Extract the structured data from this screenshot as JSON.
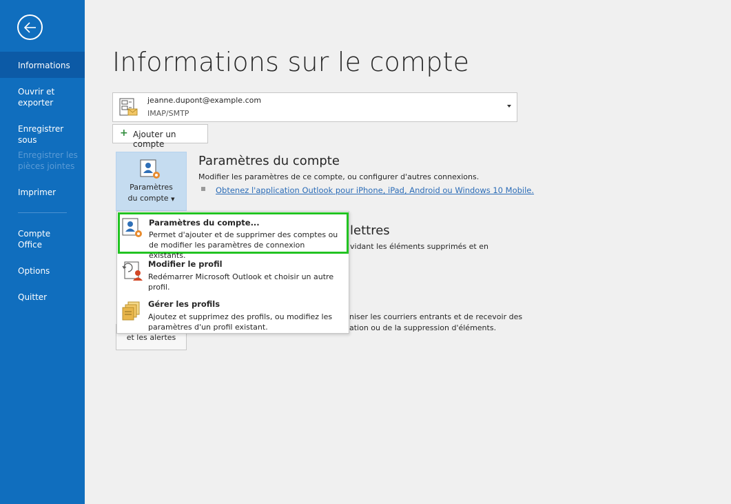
{
  "sidebar": {
    "back_label": "",
    "items": [
      {
        "label": "Informations"
      },
      {
        "label": "Ouvrir et\nexporter"
      },
      {
        "label": "Enregistrer sous"
      },
      {
        "label": "Enregistrer les\npièces jointes"
      },
      {
        "label": "Imprimer"
      },
      {
        "label": "Compte\nOffice"
      },
      {
        "label": "Options"
      },
      {
        "label": "Quitter"
      }
    ]
  },
  "page": {
    "title": "Informations sur le compte"
  },
  "account": {
    "email": "jeanne.dupont@example.com",
    "type": "IMAP/SMTP"
  },
  "add_account": {
    "label": "Ajouter un compte"
  },
  "account_settings": {
    "tile_label_line1": "Paramètres",
    "tile_label_line2": "du compte",
    "title": "Paramètres du compte",
    "description": "Modifier les paramètres de ce compte, ou configurer d'autres connexions.",
    "link": "Obtenez l'application Outlook pour iPhone, iPad, Android ou Windows 10 Mobile."
  },
  "background_sections": {
    "mailbox_title_partial": "lettres",
    "mailbox_text_partial": "vidant les éléments supprimés et en",
    "rules_text_line1_partial": "niser les courriers entrants et de recevoir des",
    "rules_text_line2_partial": "ation ou de la suppression d'éléments.",
    "alerts_tile_label": "et les alertes"
  },
  "menu": {
    "items": [
      {
        "title": "Paramètres du compte...",
        "description": "Permet d'ajouter et de supprimer des comptes ou de modifier les paramètres de connexion existants."
      },
      {
        "title": "Modifier le profil",
        "description": "Redémarrer Microsoft Outlook et choisir un autre profil."
      },
      {
        "title": "Gérer les profils",
        "description": "Ajoutez et supprimez des profils, ou modifiez les paramètres d'un profil existant."
      }
    ]
  },
  "colors": {
    "sidebar_bg": "#106ebe",
    "sidebar_active": "#0c5aa6",
    "tile_selected": "#c5dcf0",
    "highlight_border": "#22c322",
    "link": "#2b6cb7"
  }
}
